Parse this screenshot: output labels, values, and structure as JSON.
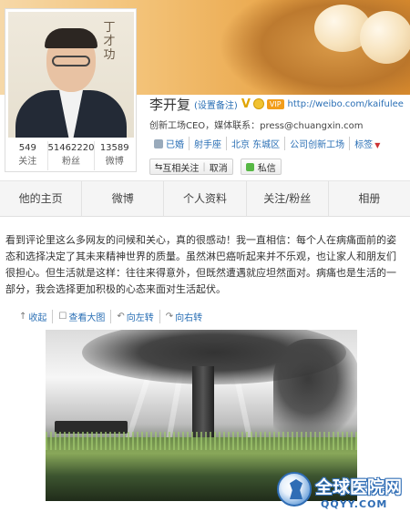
{
  "profile": {
    "name": "李开复",
    "remark": "(设置备注)",
    "v_badge": "V",
    "vip": "VIP",
    "url": "http://weibo.com/kaifulee",
    "title": "创新工场CEO，媒体联系：press@chuangxin.com",
    "tags": [
      "已婚",
      "射手座",
      "北京 东城区",
      "公司创新工场",
      "标签"
    ],
    "follow_label": "互相关注",
    "cancel_label": "取消",
    "message_label": "私信",
    "avatar_calligraphy": "丁 才 功"
  },
  "stats": [
    {
      "value": "549",
      "label": "关注"
    },
    {
      "value": "51462220",
      "label": "粉丝"
    },
    {
      "value": "13589",
      "label": "微博"
    }
  ],
  "tabs": [
    "他的主页",
    "微博",
    "个人资料",
    "关注/粉丝",
    "相册"
  ],
  "post": {
    "text": "看到评论里这么多网友的问候和关心，真的很感动！我一直相信：每个人在病痛面前的姿态和选择决定了其未来精神世界的质量。虽然淋巴癌听起来并不乐观，也让家人和朋友们很担心。但生活就是这样：往往来得意外，但既然遭遇就应坦然面对。病痛也是生活的一部分，我会选择更加积极的心态来面对生活起伏。"
  },
  "media_tools": [
    {
      "icon": "↑",
      "label": "收起"
    },
    {
      "icon": "☐",
      "label": "查看大图"
    },
    {
      "icon": "↶",
      "label": "向左转"
    },
    {
      "icon": "↷",
      "label": "向右转"
    }
  ],
  "watermark": {
    "cn": "全球医院网",
    "en": "QQYY.COM"
  }
}
